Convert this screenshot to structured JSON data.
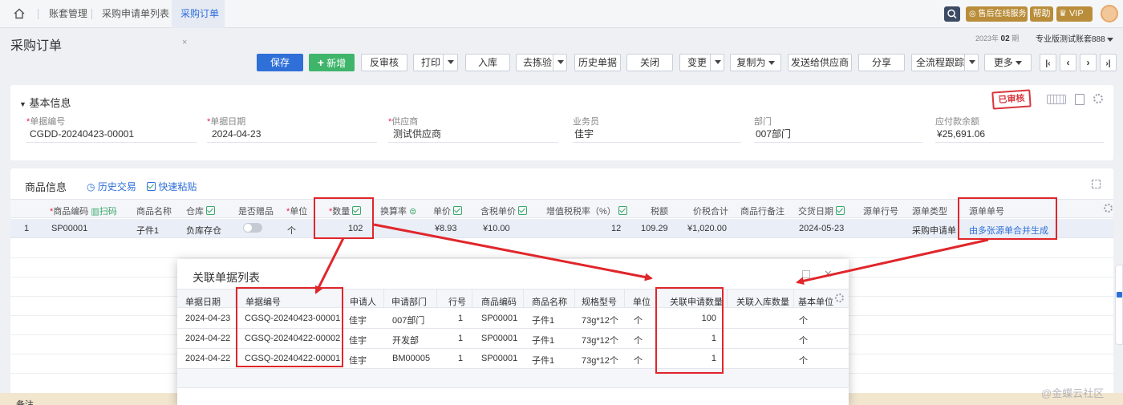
{
  "tabs": {
    "home": "",
    "account": "账套管理",
    "request_list": "采购申请单列表",
    "order": "采购订单"
  },
  "header": {
    "after_sales": "售后在线服务",
    "help": "帮助",
    "vip": "VIP",
    "period_prefix": "2023年",
    "period_num": "02",
    "period_suffix": "期",
    "account_name": "专业版测试账套888"
  },
  "page": {
    "title": "采购订单"
  },
  "toolbar": {
    "save": "保存",
    "new": "新增",
    "unaudit": "反审核",
    "print": "打印",
    "stock_in": "入库",
    "inspect": "去拣验",
    "history_docs": "历史单据",
    "close": "关闭",
    "change": "变更",
    "copy_as": "复制为",
    "send_supplier": "发送给供应商",
    "share": "分享",
    "trace": "全流程跟踪",
    "more": "更多"
  },
  "basic": {
    "section_title": "基本信息",
    "stamp": "已审核",
    "fields": [
      {
        "label": "单据编号",
        "required": true,
        "value": "CGDD-20240423-00001"
      },
      {
        "label": "单据日期",
        "required": true,
        "value": "2024-04-23"
      },
      {
        "label": "供应商",
        "required": true,
        "value": "测试供应商"
      },
      {
        "label": "业务员",
        "required": false,
        "value": "佳宇"
      },
      {
        "label": "部门",
        "required": false,
        "value": "007部门"
      },
      {
        "label": "应付款余额",
        "required": false,
        "value": "¥25,691.06"
      }
    ]
  },
  "goods": {
    "section_title": "商品信息",
    "history_trade": "历史交易",
    "quick_paste": "快速粘贴",
    "scan": "扫码",
    "columns": {
      "code": "商品编码",
      "name": "商品名称",
      "warehouse": "仓库",
      "gift": "是否赠品",
      "unit": "单位",
      "qty": "数量",
      "rate": "换算率",
      "price": "单价",
      "tax_price": "含税单价",
      "vat": "增值税税率（%）",
      "tax": "税额",
      "total": "价税合计",
      "remark": "商品行备注",
      "delivery": "交货日期",
      "src_line": "源单行号",
      "src_type": "源单类型",
      "src_no": "源单单号"
    },
    "row": {
      "idx": "1",
      "code": "SP00001",
      "name": "子件1",
      "warehouse": "负库存仓",
      "unit": "个",
      "qty": "102",
      "price": "¥8.93",
      "tax_price": "¥10.00",
      "vat": "12",
      "tax": "109.29",
      "total": "¥1,020.00",
      "delivery": "2024-05-23",
      "src_type": "采购申请单",
      "src_no": "由多张源单合并生成"
    }
  },
  "bottom": {
    "remark": "备注"
  },
  "modal": {
    "title": "关联单据列表",
    "columns": {
      "date": "单据日期",
      "no": "单据编号",
      "applicant": "申请人",
      "dept": "申请部门",
      "line": "行号",
      "code": "商品编码",
      "name": "商品名称",
      "spec": "规格型号",
      "unit": "单位",
      "req_qty": "关联申请数量",
      "in_qty": "关联入库数量",
      "base_unit": "基本单位"
    },
    "rows": [
      {
        "date": "2024-04-23",
        "no": "CGSQ-20240423-00001",
        "applicant": "佳宇",
        "dept": "007部门",
        "line": "1",
        "code": "SP00001",
        "name": "子件1",
        "spec": "73g*12个",
        "unit": "个",
        "req_qty": "100",
        "in_qty": "",
        "base_unit": "个"
      },
      {
        "date": "2024-04-22",
        "no": "CGSQ-20240422-00002",
        "applicant": "佳宇",
        "dept": "开发部",
        "line": "1",
        "code": "SP00001",
        "name": "子件1",
        "spec": "73g*12个",
        "unit": "个",
        "req_qty": "1",
        "in_qty": "",
        "base_unit": "个"
      },
      {
        "date": "2024-04-22",
        "no": "CGSQ-20240422-00001",
        "applicant": "佳宇",
        "dept": "BM00005",
        "line": "1",
        "code": "SP00001",
        "name": "子件1",
        "spec": "73g*12个",
        "unit": "个",
        "req_qty": "1",
        "in_qty": "",
        "base_unit": "个"
      }
    ]
  },
  "watermark": "@金蝶云社区",
  "colors": {
    "primary": "#2f6fd8",
    "green": "#3fb56b",
    "highlight_red": "#e0262b",
    "stamp_red": "#d9363e"
  }
}
